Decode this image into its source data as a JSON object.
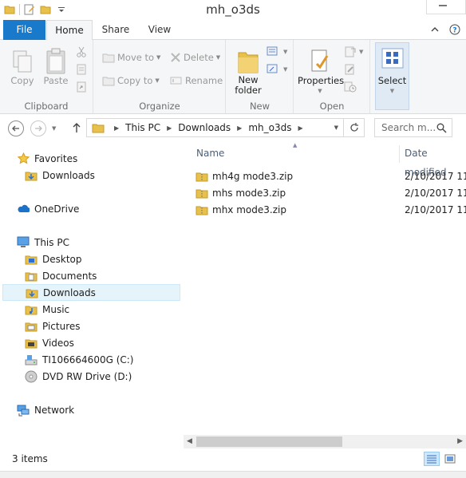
{
  "window": {
    "title": "mh_o3ds"
  },
  "ribbon_tabs": [
    "File",
    "Home",
    "Share",
    "View"
  ],
  "ribbon": {
    "clipboard": {
      "copy": "Copy",
      "paste": "Paste",
      "label": "Clipboard"
    },
    "organize": {
      "move_to": "Move to",
      "copy_to": "Copy to",
      "delete": "Delete",
      "rename": "Rename",
      "label": "Organize"
    },
    "new": {
      "new_folder_line1": "New",
      "new_folder_line2": "folder",
      "label": "New"
    },
    "open": {
      "properties": "Properties",
      "label": "Open"
    },
    "select": {
      "select": "Select"
    }
  },
  "address": {
    "breadcrumbs": [
      "This PC",
      "Downloads",
      "mh_o3ds"
    ],
    "search_placeholder": "Search m..."
  },
  "nav_pane": {
    "favorites": "Favorites",
    "fav_downloads": "Downloads",
    "onedrive": "OneDrive",
    "this_pc": "This PC",
    "items": [
      "Desktop",
      "Documents",
      "Downloads",
      "Music",
      "Pictures",
      "Videos",
      "TI106664600G (C:)",
      "DVD RW Drive (D:)"
    ],
    "network": "Network",
    "selected": "Downloads"
  },
  "columns": {
    "name": "Name",
    "date": "Date modified"
  },
  "files": [
    {
      "name": "mh4g mode3.zip",
      "date": "2/10/2017 11:"
    },
    {
      "name": "mhs mode3.zip",
      "date": "2/10/2017 11:"
    },
    {
      "name": "mhx mode3.zip",
      "date": "2/10/2017 11:"
    }
  ],
  "status": {
    "count": "3 items"
  },
  "colors": {
    "file_tab": "#1979ca",
    "folder": "#e8c14d",
    "selection": "#e5f3fb"
  },
  "icons": [
    "folder-icon",
    "properties-icon",
    "undo-icon",
    "back-icon",
    "forward-icon",
    "up-icon",
    "refresh-icon",
    "search-icon",
    "star-icon",
    "onedrive-icon",
    "computer-icon",
    "drive-icon",
    "dvd-icon",
    "network-icon",
    "zip-folder-icon"
  ]
}
